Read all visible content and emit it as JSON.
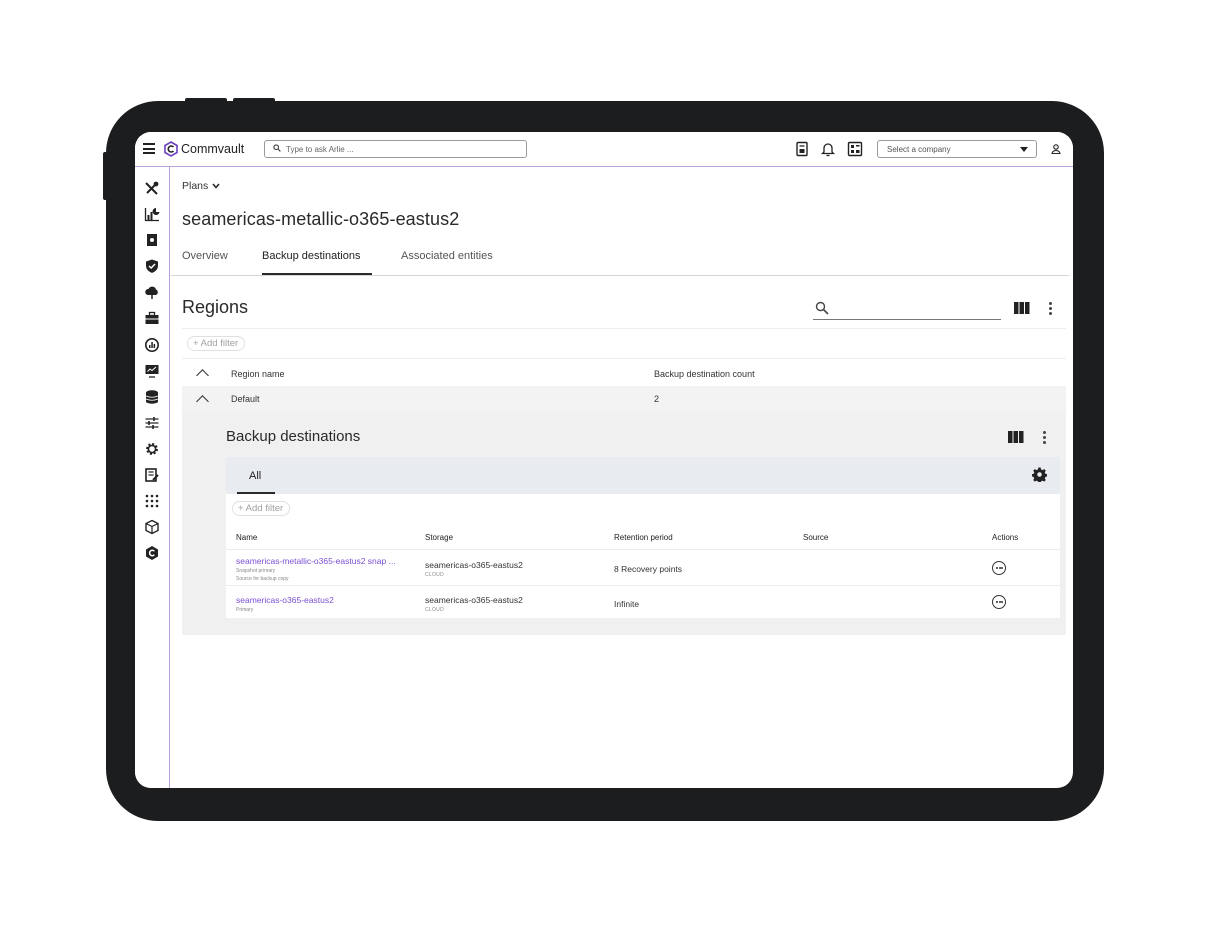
{
  "topbar": {
    "brand": "Commvault",
    "search_placeholder": "Type to ask Arlie ...",
    "company_select": "Select a company"
  },
  "breadcrumb": {
    "label": "Plans"
  },
  "page_title": "seamericas-metallic-o365-eastus2",
  "tabs": [
    {
      "label": "Overview"
    },
    {
      "label": "Backup destinations"
    },
    {
      "label": "Associated entities"
    }
  ],
  "regions": {
    "title": "Regions",
    "add_filter": "+ Add filter",
    "columns": [
      "Region name",
      "Backup destination count"
    ],
    "rows": [
      {
        "name": "Default",
        "count": "2"
      }
    ]
  },
  "backup_destinations": {
    "title": "Backup destinations",
    "tab": "All",
    "add_filter": "+ Add filter",
    "columns": [
      "Name",
      "Storage",
      "Retention period",
      "Source",
      "Actions"
    ],
    "rows": [
      {
        "name": "seamericas-metallic-o365-eastus2 snap ...",
        "sub1": "Snapshot primary",
        "sub2": "Source for backup copy",
        "storage": "seamericas-o365-eastus2",
        "storage_type": "CLOUD",
        "retention": "8 Recovery points",
        "source": ""
      },
      {
        "name": "seamericas-o365-eastus2",
        "sub1": "Primary",
        "sub2": "",
        "storage": "seamericas-o365-eastus2",
        "storage_type": "CLOUD",
        "retention": "Infinite",
        "source": ""
      }
    ]
  },
  "colors": {
    "accent": "#7b4fd6",
    "device": "#1b1d1e",
    "divider": "#b8a4d6"
  }
}
